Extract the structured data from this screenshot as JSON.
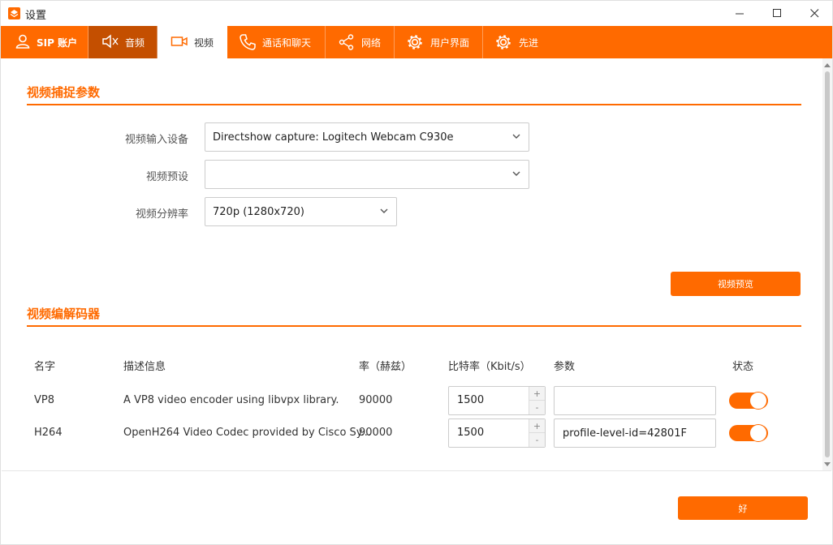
{
  "window": {
    "title": "设置"
  },
  "tabs": [
    {
      "label": "SIP 账户",
      "icon": "user-icon"
    },
    {
      "label": "音频",
      "icon": "speaker-icon"
    },
    {
      "label": "视频",
      "icon": "video-camera-icon"
    },
    {
      "label": "通话和聊天",
      "icon": "phone-icon"
    },
    {
      "label": "网络",
      "icon": "share-icon"
    },
    {
      "label": "用户界面",
      "icon": "gear-icon"
    },
    {
      "label": "先进",
      "icon": "gear-icon"
    }
  ],
  "capture": {
    "title": "视频捕捉参数",
    "device_label": "视频输入设备",
    "device_value": "Directshow capture: Logitech Webcam C930e",
    "preset_label": "视频预设",
    "preset_value": "",
    "resolution_label": "视频分辨率",
    "resolution_value": "720p (1280x720)",
    "preview_button": "视频预览"
  },
  "codecs": {
    "title": "视频编解码器",
    "headers": {
      "name": "名字",
      "description": "描述信息",
      "rate": "率（赫兹）",
      "bitrate": "比特率（Kbit/s）",
      "params": "参数",
      "status": "状态"
    },
    "rows": [
      {
        "name": "VP8",
        "description": "A VP8 video encoder using libvpx library.",
        "rate": "90000",
        "bitrate": "1500",
        "params": "",
        "enabled": true
      },
      {
        "name": "H264",
        "description": "OpenH264 Video Codec provided by Cisco Sy...",
        "rate": "90000",
        "bitrate": "1500",
        "params": "profile-level-id=42801F",
        "enabled": true
      }
    ]
  },
  "footer": {
    "ok_button": "好"
  },
  "colors": {
    "accent": "#ff6a00",
    "accent_dark": "#c44f00"
  }
}
